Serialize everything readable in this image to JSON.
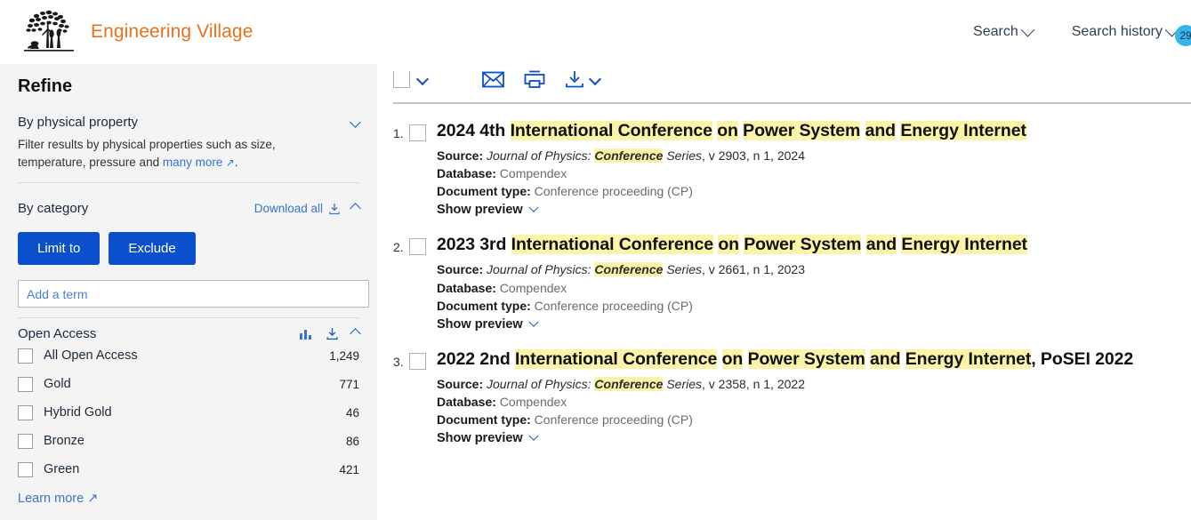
{
  "header": {
    "brand": "Engineering Village",
    "logo_icon": "tree-village-logo",
    "search_label": "Search",
    "search_history_label": "Search history",
    "history_badge": "29"
  },
  "sidebar": {
    "title": "Refine",
    "physical_property": {
      "title": "By physical property",
      "chevron_icon": "chevron-down-icon",
      "helper_pre": "Filter results by physical properties such as size, temperature, pressure and ",
      "helper_link": "many more",
      "helper_post": "."
    },
    "category": {
      "title": "By category",
      "download_all": "Download all",
      "download_icon": "download-icon",
      "chevron_icon": "chevron-up-icon"
    },
    "buttons": {
      "limit_to": "Limit to",
      "exclude": "Exclude"
    },
    "term_input": {
      "placeholder": "Add a term",
      "value": ""
    },
    "open_access": {
      "title": "Open Access",
      "chart_icon": "bar-chart-icon",
      "download_icon": "download-icon",
      "chevron_icon": "chevron-up-icon",
      "items": [
        {
          "label": "All Open Access",
          "count": "1,249"
        },
        {
          "label": "Gold",
          "count": "771"
        },
        {
          "label": "Hybrid Gold",
          "count": "46"
        },
        {
          "label": "Bronze",
          "count": "86"
        },
        {
          "label": "Green",
          "count": "421"
        }
      ],
      "learn_more": "Learn more"
    }
  },
  "toolbar": {
    "select_all_icon": "checkbox-icon",
    "select_all_chevron": "chevron-down-icon",
    "email_icon": "envelope-icon",
    "print_icon": "printer-icon",
    "download_icon": "download-icon",
    "download_chevron": "chevron-down-icon"
  },
  "results": [
    {
      "number": "1.",
      "title_parts": [
        {
          "text": "2024 4th ",
          "hl": false
        },
        {
          "text": "International Conference",
          "hl": true
        },
        {
          "text": " ",
          "hl": false
        },
        {
          "text": "on",
          "hl": true
        },
        {
          "text": " ",
          "hl": false
        },
        {
          "text": "Power System",
          "hl": true
        },
        {
          "text": " ",
          "hl": false
        },
        {
          "text": "and",
          "hl": true
        },
        {
          "text": " ",
          "hl": false
        },
        {
          "text": "Energy Internet",
          "hl": true
        }
      ],
      "source_label": "Source:",
      "source_journal": "Journal of Physics:",
      "source_hl": "Conference",
      "source_series": "Series",
      "source_rest": ", v 2903, n 1, 2024",
      "database_label": "Database:",
      "database_value": "Compendex",
      "doctype_label": "Document type:",
      "doctype_value": "Conference proceeding (CP)",
      "show_preview": "Show preview"
    },
    {
      "number": "2.",
      "title_parts": [
        {
          "text": "2023 3rd ",
          "hl": false
        },
        {
          "text": "International Conference",
          "hl": true
        },
        {
          "text": " ",
          "hl": false
        },
        {
          "text": "on",
          "hl": true
        },
        {
          "text": " ",
          "hl": false
        },
        {
          "text": "Power System",
          "hl": true
        },
        {
          "text": " ",
          "hl": false
        },
        {
          "text": "and",
          "hl": true
        },
        {
          "text": " ",
          "hl": false
        },
        {
          "text": "Energy Internet",
          "hl": true
        }
      ],
      "source_label": "Source:",
      "source_journal": "Journal of Physics:",
      "source_hl": "Conference",
      "source_series": "Series",
      "source_rest": ", v 2661, n 1, 2023",
      "database_label": "Database:",
      "database_value": "Compendex",
      "doctype_label": "Document type:",
      "doctype_value": "Conference proceeding (CP)",
      "show_preview": "Show preview"
    },
    {
      "number": "3.",
      "title_parts": [
        {
          "text": "2022 2nd ",
          "hl": false
        },
        {
          "text": "International Conference",
          "hl": true
        },
        {
          "text": " ",
          "hl": false
        },
        {
          "text": "on",
          "hl": true
        },
        {
          "text": " ",
          "hl": false
        },
        {
          "text": "Power System",
          "hl": true
        },
        {
          "text": " ",
          "hl": false
        },
        {
          "text": "and",
          "hl": true
        },
        {
          "text": " ",
          "hl": false
        },
        {
          "text": "Energy Internet",
          "hl": true
        },
        {
          "text": ", PoSEI 2022",
          "hl": false
        }
      ],
      "source_label": "Source:",
      "source_journal": "Journal of Physics:",
      "source_hl": "Conference",
      "source_series": "Series",
      "source_rest": ", v 2358, n 1, 2022",
      "database_label": "Database:",
      "database_value": "Compendex",
      "doctype_label": "Document type:",
      "doctype_value": "Conference proceeding (CP)",
      "show_preview": "Show preview"
    }
  ],
  "colors": {
    "brand_orange": "#e9711c",
    "button_blue": "#0a50cc",
    "link_blue": "#3a72d6",
    "highlight_yellow": "#fbf4a8",
    "sidebar_bg": "#f4f4f4",
    "badge_blue": "#3ab4e8"
  }
}
